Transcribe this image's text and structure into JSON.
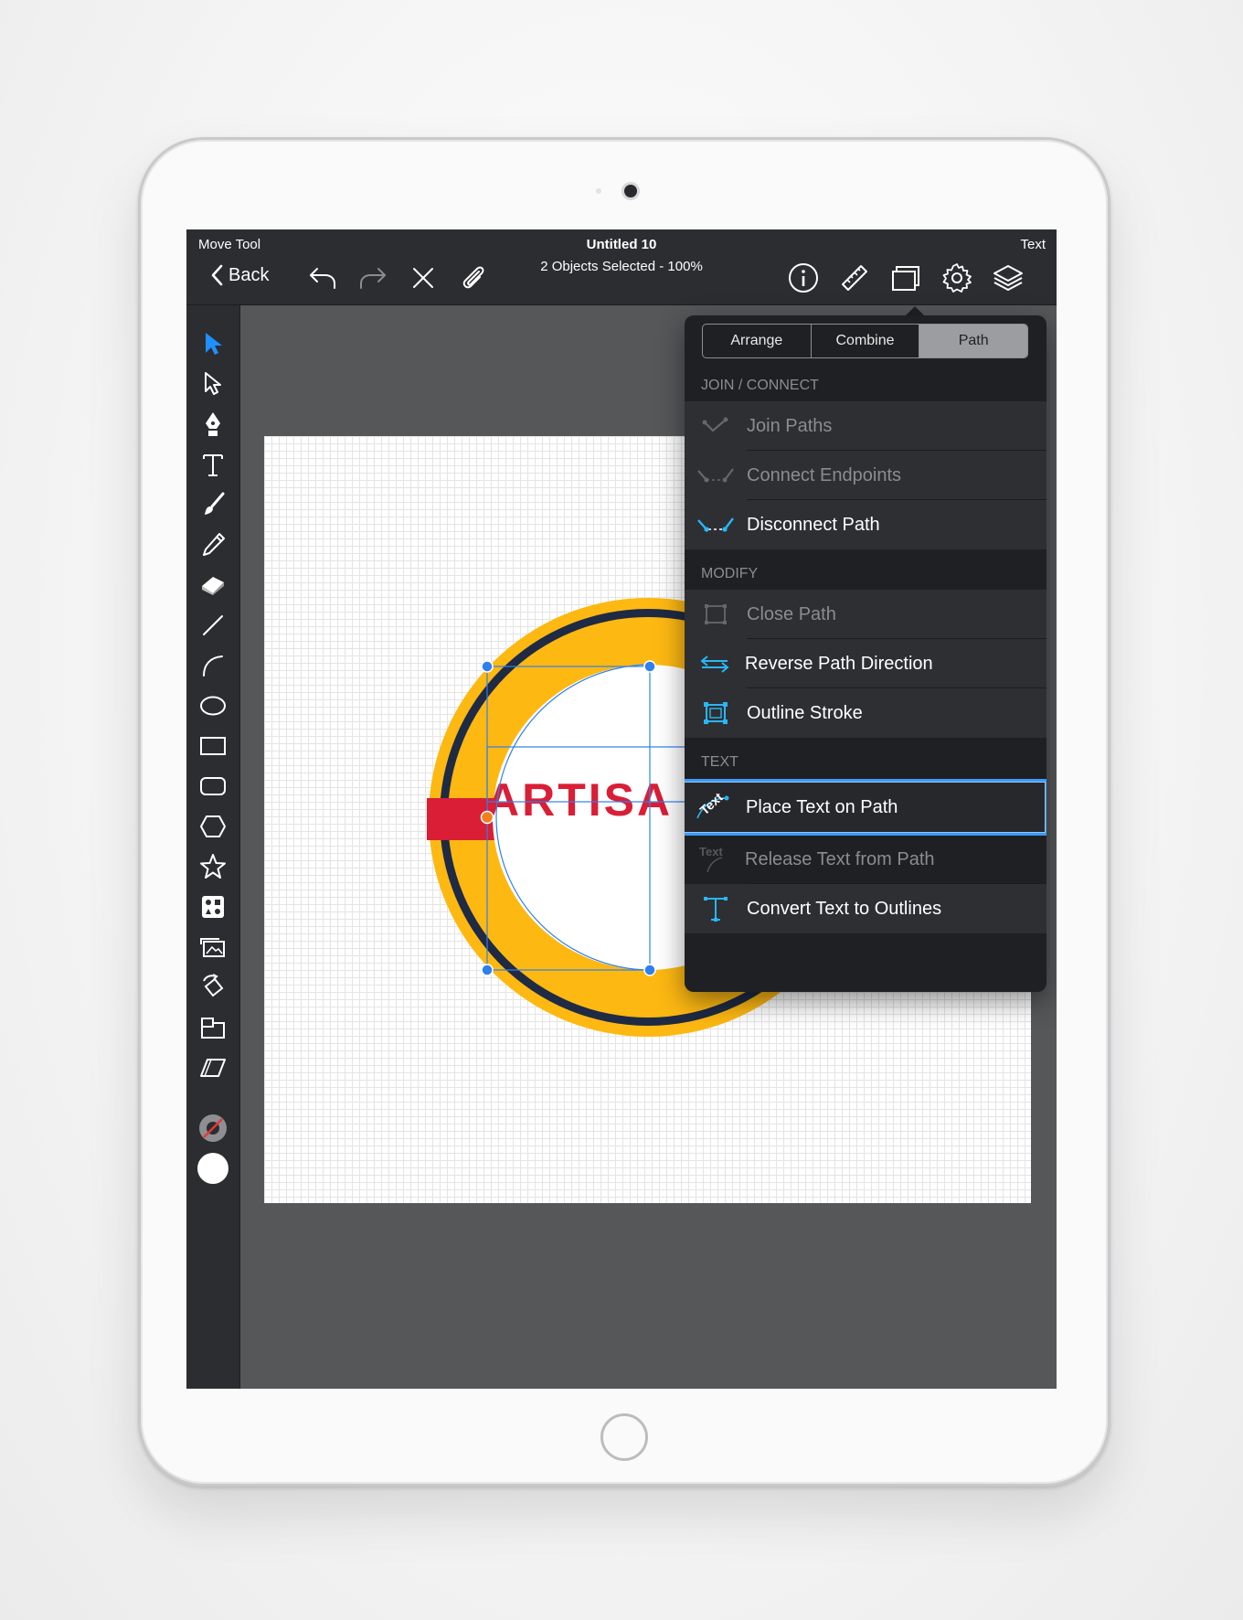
{
  "app": {
    "mode_label": "Move Tool",
    "title": "Untitled 10",
    "subtitle": "2 Objects Selected - 100%",
    "right_label": "Text",
    "back_label": "Back"
  },
  "toolbar_icons": [
    "select-arrow-icon",
    "direct-select-icon",
    "pen-icon",
    "text-tool-icon",
    "brush-icon",
    "pencil-icon",
    "eraser-icon",
    "line-icon",
    "arc-icon",
    "ellipse-icon",
    "rectangle-icon",
    "rounded-rect-icon",
    "hexagon-icon",
    "star-icon",
    "symbols-icon",
    "image-icon",
    "rotate-icon",
    "scale-icon",
    "skew-icon"
  ],
  "canvas": {
    "logo_text": "ARTISA",
    "colors": {
      "ring_outer": "#FDB812",
      "ring_inner": "#1F2A44",
      "accent_red": "#D91E36",
      "selection": "#2F80ED"
    }
  },
  "popover": {
    "tabs": [
      "Arrange",
      "Combine",
      "Path"
    ],
    "active_tab": "Path",
    "sections": [
      {
        "header": "JOIN / CONNECT",
        "items": [
          {
            "label": "Join Paths",
            "enabled": false
          },
          {
            "label": "Connect Endpoints",
            "enabled": false
          },
          {
            "label": "Disconnect Path",
            "enabled": true
          }
        ]
      },
      {
        "header": "MODIFY",
        "items": [
          {
            "label": "Close Path",
            "enabled": false
          },
          {
            "label": "Reverse Path Direction",
            "enabled": true
          },
          {
            "label": "Outline Stroke",
            "enabled": true
          }
        ]
      },
      {
        "header": "TEXT",
        "items": [
          {
            "label": "Place Text on Path",
            "enabled": true
          },
          {
            "label": "Release Text from Path",
            "enabled": false
          },
          {
            "label": "Convert Text to Outlines",
            "enabled": true
          }
        ]
      }
    ],
    "text_on_path_icon_label": "Text"
  }
}
